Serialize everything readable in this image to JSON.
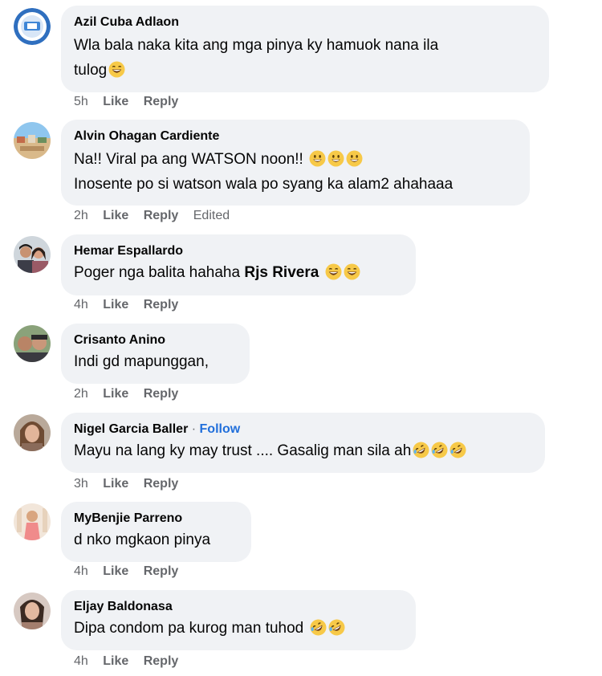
{
  "comments": [
    {
      "author": "Azil Cuba Adlaon",
      "line1": "Wla bala naka kita ang mga pinya ky hamuok nana ila",
      "line2": "tulog",
      "time": "5h",
      "like": "Like",
      "reply": "Reply",
      "emoji": [
        "laughing-emoji"
      ]
    },
    {
      "author": "Alvin Ohagan Cardiente",
      "line1": "Na!! Viral pa ang WATSON noon!!",
      "line2": "Inosente po si watson wala po syang ka alam2 ahahaaa",
      "time": "2h",
      "like": "Like",
      "reply": "Reply",
      "edited": "Edited",
      "emoji": [
        "grinning-emoji",
        "grinning-emoji",
        "grinning-emoji"
      ]
    },
    {
      "author": "Hemar Espallardo",
      "line1": "Poger nga balita hahaha",
      "mention": "Rjs Rivera",
      "time": "4h",
      "like": "Like",
      "reply": "Reply",
      "emoji": [
        "laughing-emoji",
        "laughing-emoji"
      ]
    },
    {
      "author": "Crisanto Anino",
      "line1": "Indi gd mapunggan,",
      "time": "2h",
      "like": "Like",
      "reply": "Reply"
    },
    {
      "author": "Nigel Garcia Baller",
      "separator": "·",
      "follow": "Follow",
      "line1": "Mayu na lang ky may trust .... Gasalig man sila ah",
      "time": "3h",
      "like": "Like",
      "reply": "Reply",
      "emoji": [
        "rofl-emoji",
        "rofl-emoji",
        "rofl-emoji"
      ]
    },
    {
      "author": "MyBenjie Parreno",
      "line1": "d nko mgkaon pinya",
      "time": "4h",
      "like": "Like",
      "reply": "Reply"
    },
    {
      "author": "Eljay Baldonasa",
      "line1": "Dipa condom pa kurog man tuhod",
      "time": "4h",
      "like": "Like",
      "reply": "Reply",
      "emoji": [
        "rofl-emoji",
        "rofl-emoji"
      ]
    }
  ],
  "colors": {
    "bubble": "#f0f2f5",
    "meta": "#65676b",
    "follow": "#216fdb",
    "emoji": "#f7c948"
  }
}
